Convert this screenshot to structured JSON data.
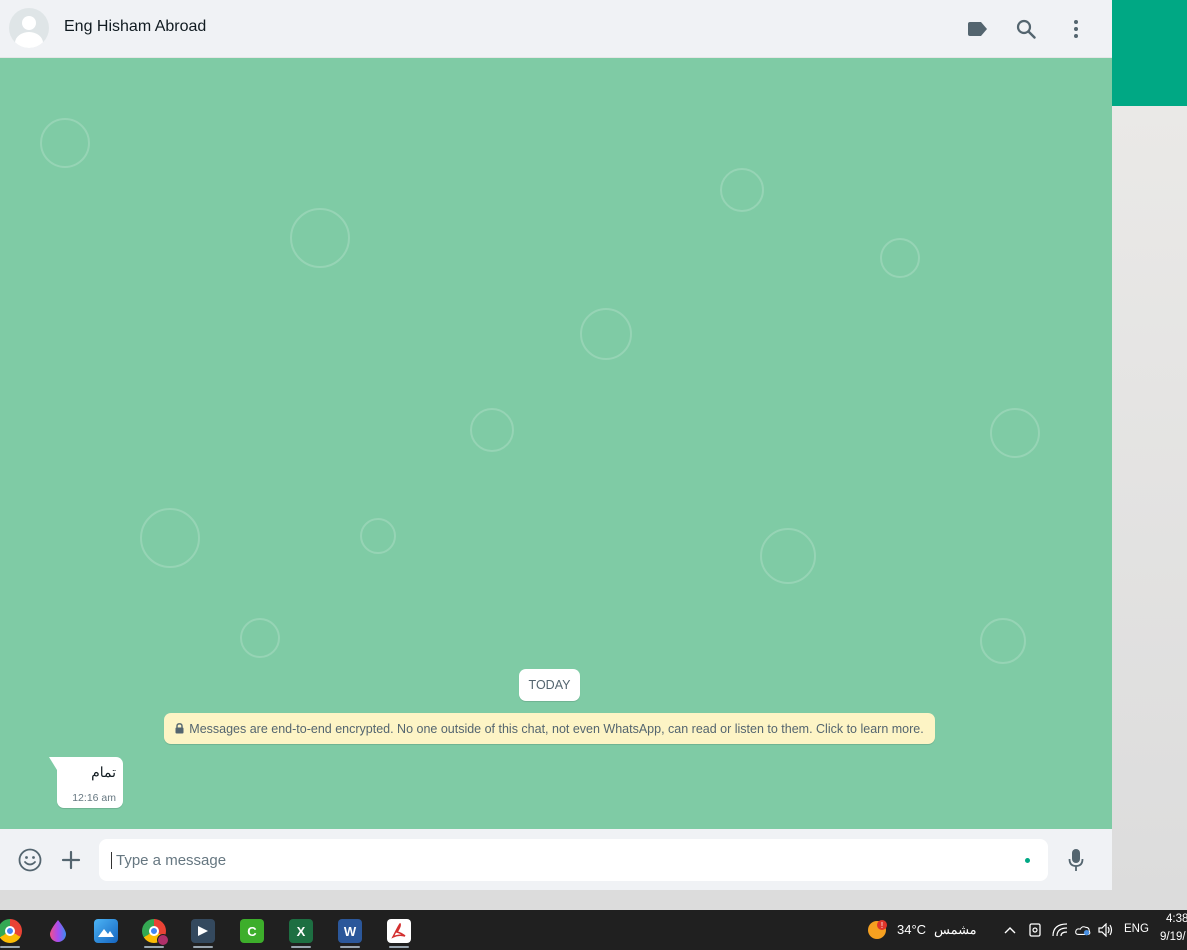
{
  "chat": {
    "contact_name": "Eng Hisham Abroad",
    "date_chip": "TODAY",
    "encryption_notice": "Messages are end-to-end encrypted. No one outside of this chat, not even WhatsApp, can read or listen to them. Click to learn more.",
    "messages": [
      {
        "text": "تمام",
        "time": "12:16 am",
        "direction": "incoming"
      }
    ],
    "composer_placeholder": "Type a message"
  },
  "header_icons": [
    "label-icon",
    "search-icon",
    "menu-icon"
  ],
  "footer_icons": [
    "emoji-icon",
    "attach-icon",
    "microphone-icon"
  ],
  "colors": {
    "wallpaper": "#7fcba5",
    "accent": "#00a884",
    "panel": "#f0f2f5",
    "notice": "#fdf4c5"
  },
  "taskbar": {
    "apps": [
      "chrome",
      "color-picker",
      "photos",
      "chrome-profile",
      "app-launcher",
      "camtasia",
      "excel",
      "word",
      "pdf-reader"
    ],
    "weather": {
      "temperature": "34°C",
      "condition": "مشمس"
    },
    "language": "ENG",
    "time": "4:38",
    "date": "9/19/"
  }
}
